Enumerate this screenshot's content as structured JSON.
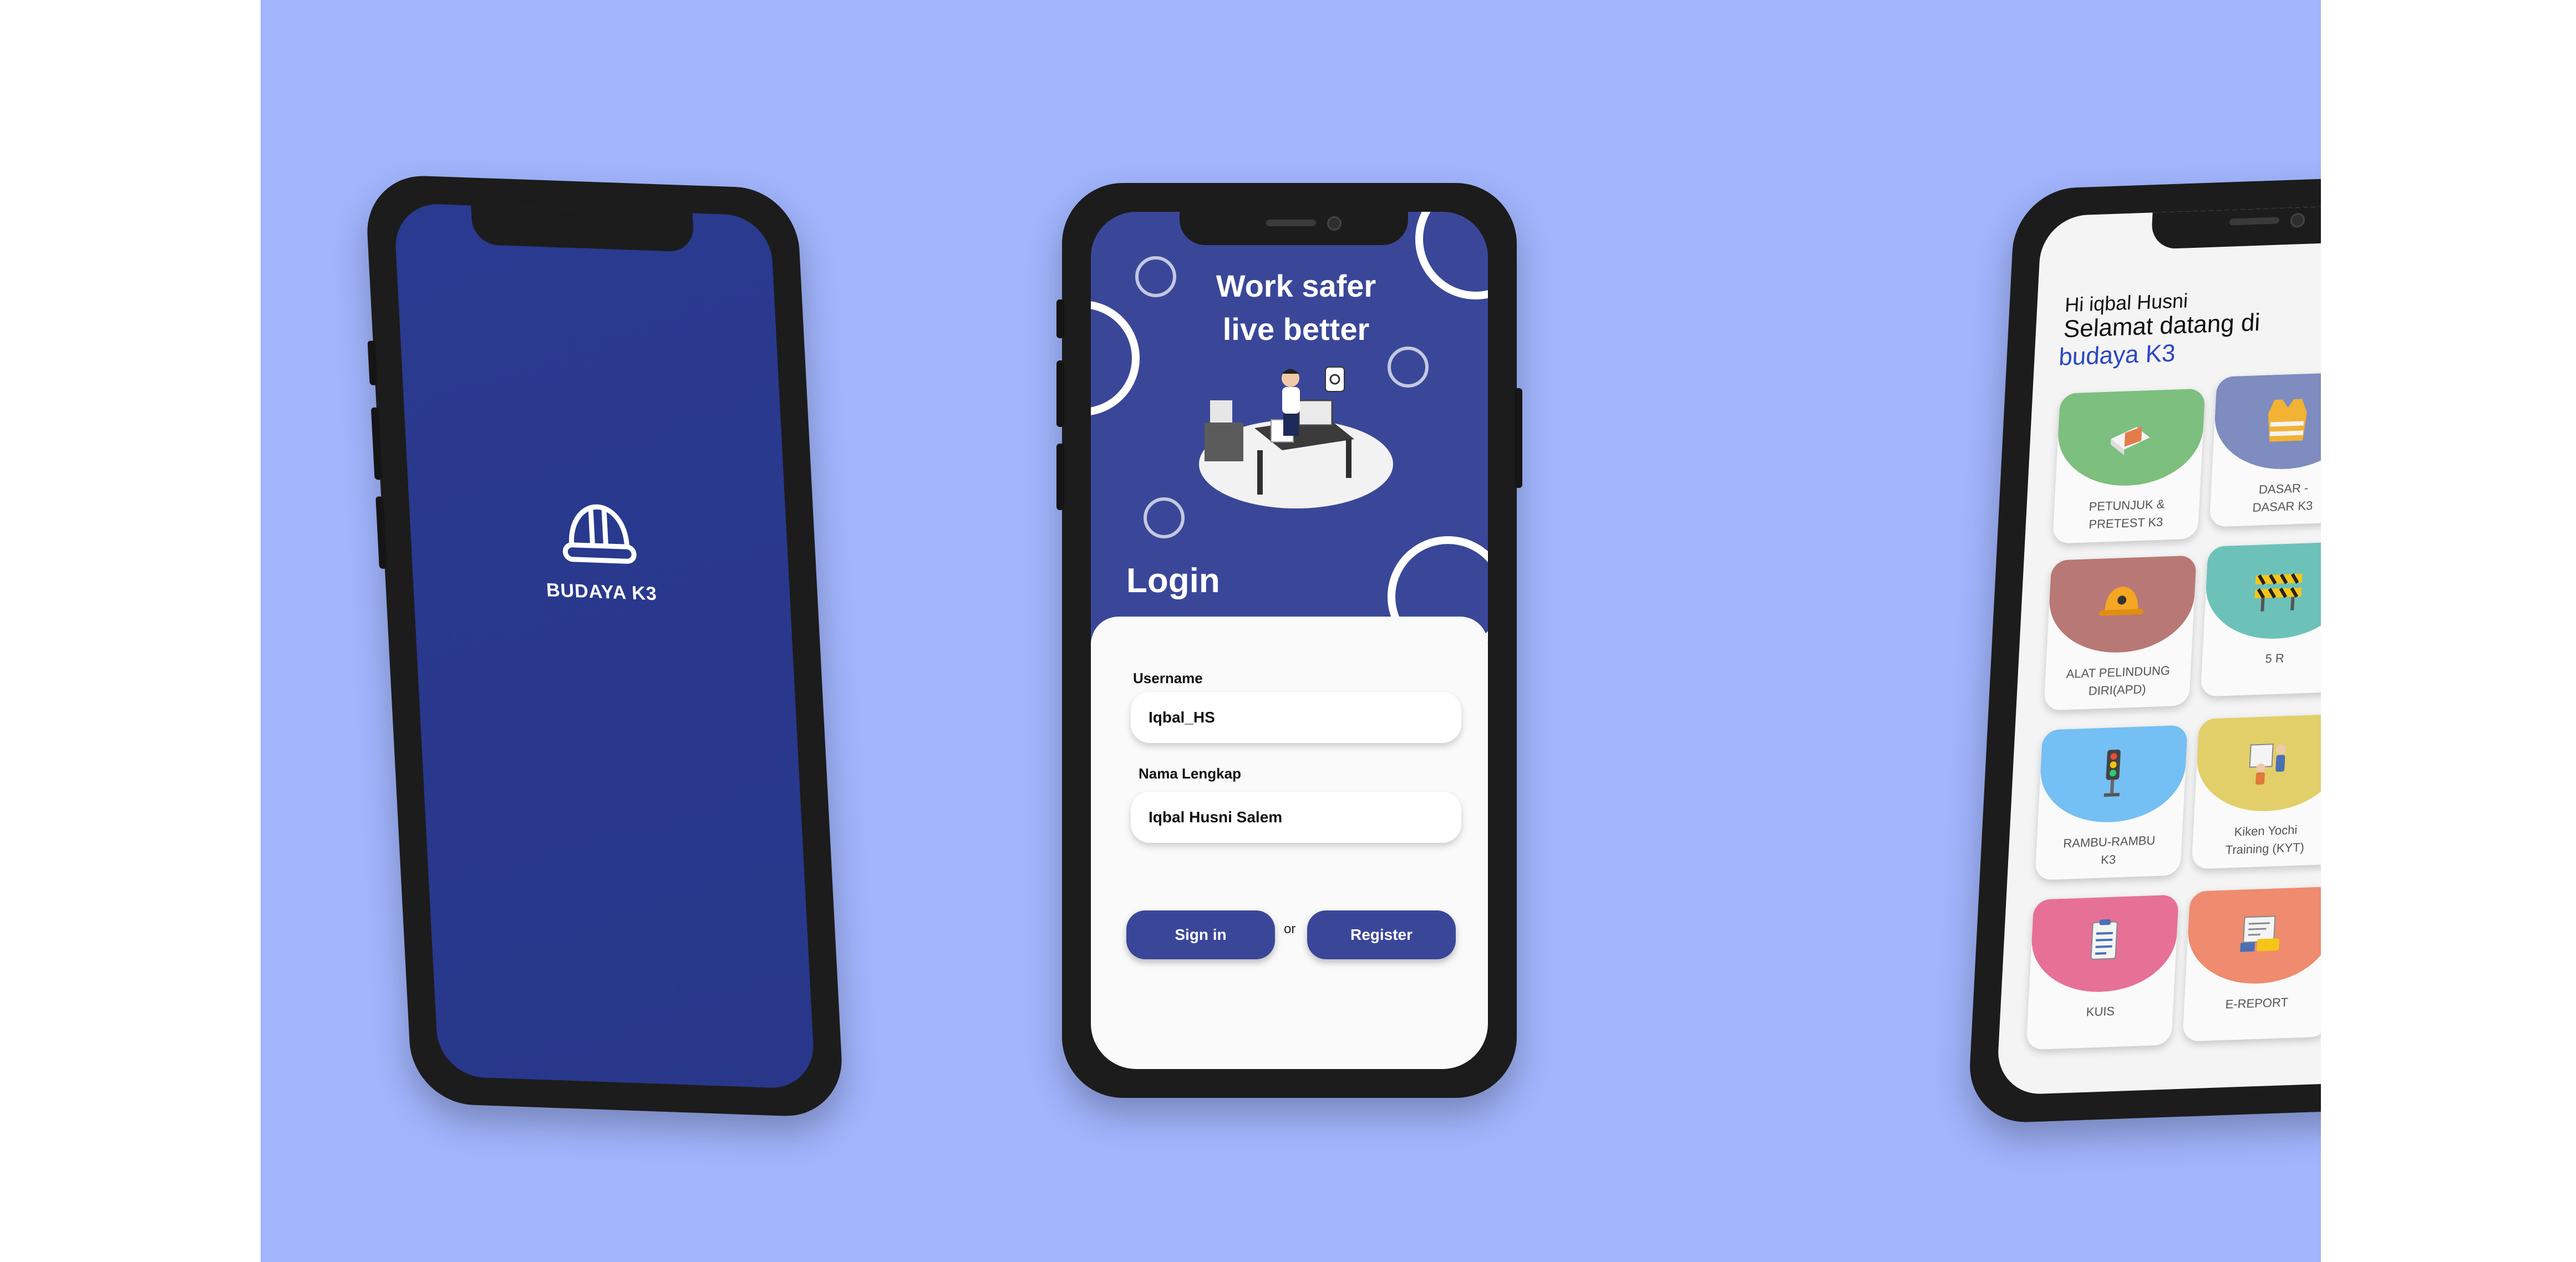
{
  "splash": {
    "app_name": "BUDAYA K3",
    "icon": "helmet-icon"
  },
  "login": {
    "hero_line1": "Work safer",
    "hero_line2": "live better",
    "title": "Login",
    "username_label": "Username",
    "username_value": "Iqbal_HS",
    "fullname_label": "Nama Lengkap",
    "fullname_value": "Iqbal Husni Salem",
    "signin_label": "Sign in",
    "or_text": "or",
    "register_label": "Register",
    "illustration": "office-worker-illustration"
  },
  "home": {
    "greeting": "Hi iqbal Husni",
    "welcome": "Selamat datang di",
    "brand": "budaya K3",
    "menu": [
      {
        "label_1": "PETUNJUK &",
        "label_2": "PRETEST K3",
        "color": "#7dbf7e",
        "icon": "book-icon"
      },
      {
        "label_1": "DASAR -",
        "label_2": "DASAR K3",
        "color": "#7f8cc0",
        "icon": "safety-vest-icon"
      },
      {
        "label_1": "ALAT PELINDUNG",
        "label_2": "DIRI(APD)",
        "color": "#b87876",
        "icon": "hard-hat-icon"
      },
      {
        "label_1": "5 R",
        "label_2": "",
        "color": "#6cc2b8",
        "icon": "barrier-icon"
      },
      {
        "label_1": "RAMBU-RAMBU",
        "label_2": "K3",
        "color": "#74bff3",
        "icon": "traffic-light-icon"
      },
      {
        "label_1": "Kiken Yochi",
        "label_2": "Training (KYT)",
        "color": "#e2cf6a",
        "icon": "training-icon"
      },
      {
        "label_1": "KUIS",
        "label_2": "",
        "color": "#e77097",
        "icon": "quiz-icon"
      },
      {
        "label_1": "E-REPORT",
        "label_2": "",
        "color": "#ef8b6e",
        "icon": "report-icon"
      }
    ]
  }
}
